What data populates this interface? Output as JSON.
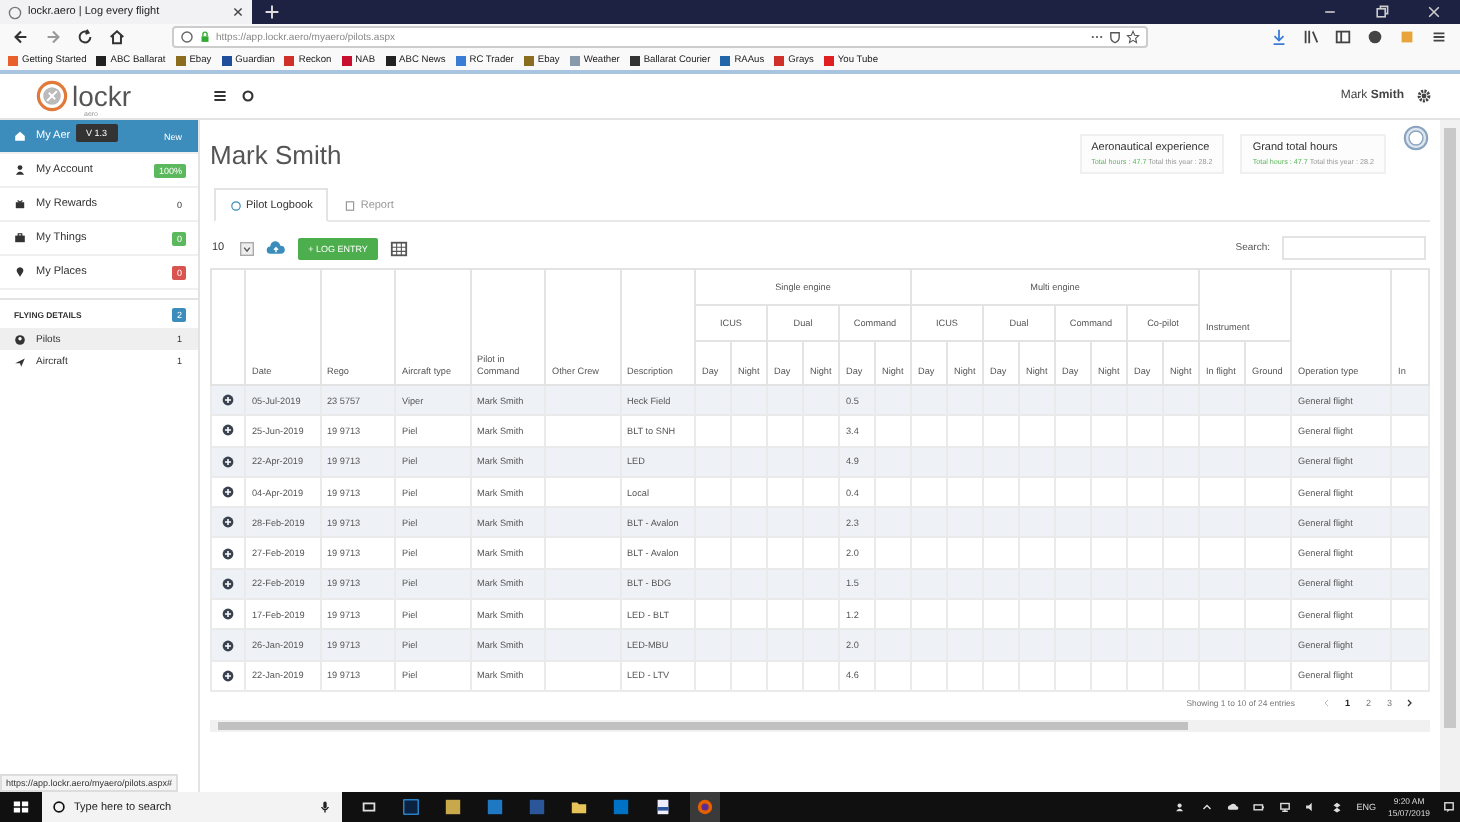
{
  "browser": {
    "tab_title": "lockr.aero | Log every flight",
    "url": "https://app.lockr.aero/myaero/pilots.aspx",
    "bookmarks": [
      {
        "label": "Getting Started",
        "color": "#e8612c"
      },
      {
        "label": "ABC Ballarat",
        "color": "#222222"
      },
      {
        "label": "Ebay",
        "color": "#8a6d1f"
      },
      {
        "label": "Guardian",
        "color": "#1f4e9c"
      },
      {
        "label": "Reckon",
        "color": "#d0302a"
      },
      {
        "label": "NAB",
        "color": "#c8102e"
      },
      {
        "label": "ABC News",
        "color": "#222222"
      },
      {
        "label": "RC Trader",
        "color": "#3a7bd5"
      },
      {
        "label": "Ebay",
        "color": "#8a6d1f"
      },
      {
        "label": "Weather",
        "color": "#8899aa"
      },
      {
        "label": "Ballarat Courier",
        "color": "#333333"
      },
      {
        "label": "RAAus",
        "color": "#2266aa"
      },
      {
        "label": "Grays",
        "color": "#d0302a"
      },
      {
        "label": "You Tube",
        "color": "#e02020"
      }
    ],
    "status_url": "https://app.lockr.aero/myaero/pilots.aspx#"
  },
  "app": {
    "logo": "lockr",
    "logo_sub": "aero",
    "user": "Mark **Smith**",
    "version_tooltip": "V 1.3"
  },
  "sidebar": {
    "items": [
      {
        "label": "My Aer",
        "badge": "New",
        "selected": true
      },
      {
        "label": "My Account",
        "badge": "100%",
        "color": "#5cb85c",
        "selected": false
      },
      {
        "label": "My Rewards",
        "badge": "0",
        "selected": false
      },
      {
        "label": "My Things",
        "badge": "0",
        "color": "#5cb85c",
        "selected": false
      },
      {
        "label": "My Places",
        "badge": "0",
        "color": "#d9534f",
        "selected": false
      }
    ],
    "section": {
      "label": "FLYING DETAILS",
      "badge": "2",
      "color": "#3c8dbc"
    },
    "sub_items": [
      {
        "label": "Pilots",
        "badge": "1",
        "selected": true
      },
      {
        "label": "Aircraft",
        "badge": "1",
        "selected": false
      }
    ]
  },
  "page": {
    "title": "Mark Smith",
    "cards": [
      {
        "title": "Aeronautical experience",
        "total_hours": "Total hours : 47.7",
        "total_year": "Total this year : 28.2"
      },
      {
        "title": "Grand total hours",
        "total_hours": "Total hours : 47.7",
        "total_year": "Total this year : 28.2"
      }
    ],
    "tabs": [
      {
        "label": "Pilot Logbook",
        "selected": true
      },
      {
        "label": "Report",
        "selected": false
      }
    ],
    "page_size": "10",
    "log_button": "+ LOG ENTRY",
    "search_label": "Search:"
  },
  "table": {
    "columns": [
      {
        "label": "Date"
      },
      {
        "label": "Rego"
      },
      {
        "label": "Aircraft type"
      },
      {
        "label": "Pilot in Command"
      },
      {
        "label": "Other Crew"
      },
      {
        "label": "Description"
      },
      {
        "label": "Single engine",
        "children": [
          {
            "label": "ICUS",
            "children": [
              {
                "label": "Day"
              },
              {
                "label": "Night"
              }
            ]
          },
          {
            "label": "Dual",
            "children": [
              {
                "label": "Day"
              },
              {
                "label": "Night"
              }
            ]
          },
          {
            "label": "Command",
            "children": [
              {
                "label": "Day"
              },
              {
                "label": "Night"
              }
            ]
          }
        ]
      },
      {
        "label": "Multi engine",
        "children": [
          {
            "label": "ICUS",
            "children": [
              {
                "label": "Day"
              },
              {
                "label": "Night"
              }
            ]
          },
          {
            "label": "Dual",
            "children": [
              {
                "label": "Day"
              },
              {
                "label": "Night"
              }
            ]
          },
          {
            "label": "Command",
            "children": [
              {
                "label": "Day"
              },
              {
                "label": "Night"
              }
            ]
          },
          {
            "label": "Co-pilot",
            "children": [
              {
                "label": "Day"
              },
              {
                "label": "Night"
              }
            ]
          }
        ]
      },
      {
        "label": "Instrument",
        "children": [
          {
            "label": "In flight"
          },
          {
            "label": "Ground"
          }
        ]
      },
      {
        "label": "Operation type"
      },
      {
        "label": "In"
      }
    ],
    "rows": [
      {
        "date": "05-Jul-2019",
        "rego": "23 5757",
        "aircraft_type": "Viper",
        "pilot_in_command": "Mark Smith",
        "description": "Heck Field",
        "single_engine_command_day": "0.5",
        "operation_type": "General flight"
      },
      {
        "date": "25-Jun-2019",
        "rego": "19 9713",
        "aircraft_type": "Piel",
        "pilot_in_command": "Mark Smith",
        "description": "BLT to SNH",
        "single_engine_command_day": "3.4",
        "operation_type": "General flight"
      },
      {
        "date": "22-Apr-2019",
        "rego": "19 9713",
        "aircraft_type": "Piel",
        "pilot_in_command": "Mark Smith",
        "description": "LED",
        "single_engine_command_day": "4.9",
        "operation_type": "General flight"
      },
      {
        "date": "04-Apr-2019",
        "rego": "19 9713",
        "aircraft_type": "Piel",
        "pilot_in_command": "Mark Smith",
        "description": "Local",
        "single_engine_command_day": "0.4",
        "operation_type": "General flight"
      },
      {
        "date": "28-Feb-2019",
        "rego": "19 9713",
        "aircraft_type": "Piel",
        "pilot_in_command": "Mark Smith",
        "description": "BLT - Avalon",
        "single_engine_command_day": "2.3",
        "operation_type": "General flight"
      },
      {
        "date": "27-Feb-2019",
        "rego": "19 9713",
        "aircraft_type": "Piel",
        "pilot_in_command": "Mark Smith",
        "description": "BLT - Avalon",
        "single_engine_command_day": "2.0",
        "operation_type": "General flight"
      },
      {
        "date": "22-Feb-2019",
        "rego": "19 9713",
        "aircraft_type": "Piel",
        "pilot_in_command": "Mark Smith",
        "description": "BLT - BDG",
        "single_engine_command_day": "1.5",
        "operation_type": "General flight"
      },
      {
        "date": "17-Feb-2019",
        "rego": "19 9713",
        "aircraft_type": "Piel",
        "pilot_in_command": "Mark Smith",
        "description": "LED - BLT",
        "single_engine_command_day": "1.2",
        "operation_type": "General flight"
      },
      {
        "date": "26-Jan-2019",
        "rego": "19 9713",
        "aircraft_type": "Piel",
        "pilot_in_command": "Mark Smith",
        "description": "LED-MBU",
        "single_engine_command_day": "2.0",
        "operation_type": "General flight"
      },
      {
        "date": "22-Jan-2019",
        "rego": "19 9713",
        "aircraft_type": "Piel",
        "pilot_in_command": "Mark Smith",
        "description": "LED - LTV",
        "single_engine_command_day": "4.6",
        "operation_type": "General flight"
      }
    ],
    "info": "Showing 1 to 10 of 24 entries",
    "pages": [
      {
        "label": "1",
        "selected": true
      },
      {
        "label": "2",
        "selected": false
      },
      {
        "label": "3",
        "selected": false
      }
    ]
  },
  "taskbar": {
    "search_placeholder": "Type here to search",
    "language": "ENG",
    "time": "9:20 AM",
    "date": "15/07/2019"
  }
}
